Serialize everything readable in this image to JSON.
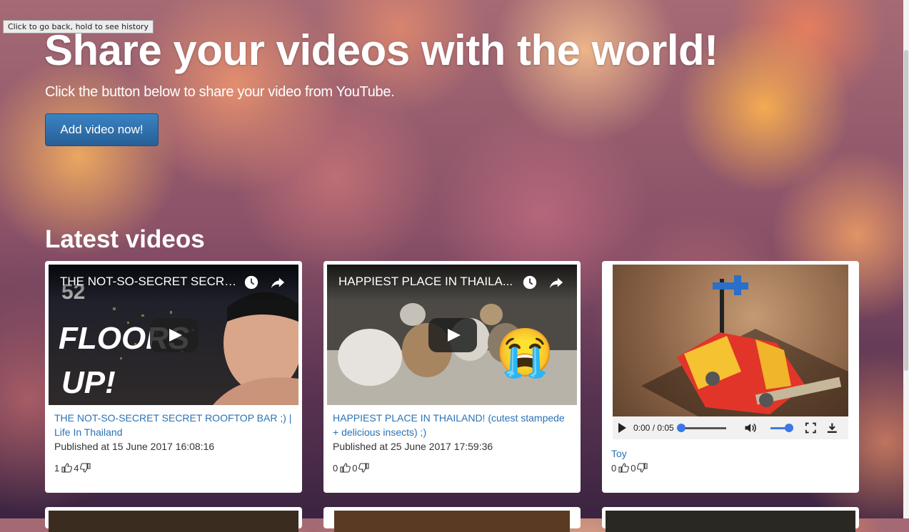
{
  "tooltip": "Click to go back, hold to see history",
  "hero": {
    "title": "Share your videos with the world!",
    "subtitle": "Click the button below to share your video from YouTube.",
    "button": "Add video now!"
  },
  "latest": {
    "heading": "Latest videos"
  },
  "cards": [
    {
      "embed_title": "THE NOT-SO-SECRET SECRE...",
      "link": "THE NOT-SO-SECRET SECRET ROOFTOP BAR ;) | Life In Thailand",
      "published": "Published at 15 June 2017 16:08:16",
      "likes": "1",
      "dislikes": "4",
      "overlay_text_1": "52",
      "overlay_text_2": "FLOORS",
      "overlay_text_3": "UP!"
    },
    {
      "embed_title": "HAPPIEST PLACE IN THAILA...",
      "link": "HAPPIEST PLACE IN THAILAND! (cutest stampede + delicious insects) ;)",
      "published": "Published at 25 June 2017 17:59:36",
      "likes": "0",
      "dislikes": "0",
      "emoji": "😭"
    },
    {
      "time": "0:00 / 0:05",
      "title": "Toy",
      "likes": "0",
      "dislikes": "0",
      "video_progress": 0,
      "volume": 1
    }
  ],
  "colors": {
    "link": "#2a72b5",
    "button": "#2e6da4",
    "player_accent": "#3b78e7"
  }
}
